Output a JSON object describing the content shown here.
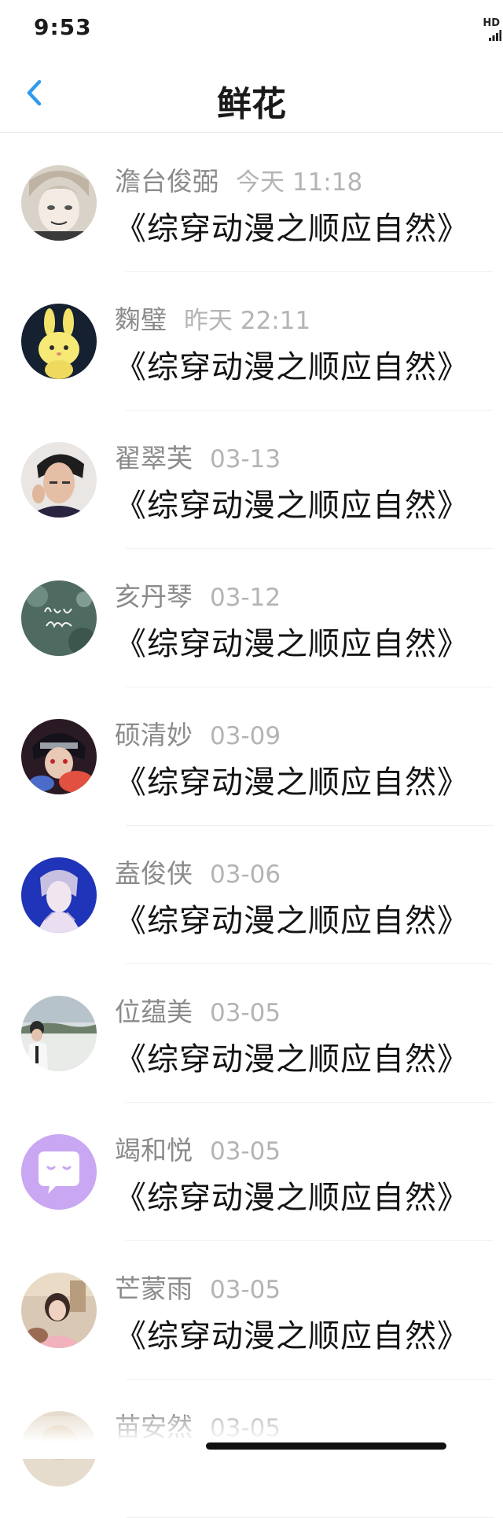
{
  "status_bar": {
    "time": "9:53",
    "hd_badge": "HD",
    "signal_icon": "signal-bars-icon"
  },
  "nav": {
    "title": "鲜花",
    "back_icon": "chevron-left-icon",
    "accent_color": "#2f9bef"
  },
  "items": [
    {
      "name": "澹台俊弼",
      "time": "今天 11:18",
      "book": "《综穿动漫之顺应自然》",
      "avatar": "anime-boy-avatar"
    },
    {
      "name": "麴璧",
      "time": "昨天 22:11",
      "book": "《综穿动漫之顺应自然》",
      "avatar": "yellow-bunny-avatar"
    },
    {
      "name": "翟翠芙",
      "time": "03-13",
      "book": "《综穿动漫之顺应自然》",
      "avatar": "young-man-avatar"
    },
    {
      "name": "亥丹琴",
      "time": "03-12",
      "book": "《综穿动漫之顺应自然》",
      "avatar": "hello-august-avatar"
    },
    {
      "name": "硕清妙",
      "time": "03-09",
      "book": "《综穿动漫之顺应自然》",
      "avatar": "ninja-avatar"
    },
    {
      "name": "盍俊侠",
      "time": "03-06",
      "book": "《综穿动漫之顺应自然》",
      "avatar": "blue-anime-avatar"
    },
    {
      "name": "位蕴美",
      "time": "03-05",
      "book": "《综穿动漫之顺应自然》",
      "avatar": "seaside-man-avatar"
    },
    {
      "name": "竭和悦",
      "time": "03-05",
      "book": "《综穿动漫之顺应自然》",
      "avatar": "purple-chat-avatar"
    },
    {
      "name": "芒蒙雨",
      "time": "03-05",
      "book": "《综穿动漫之顺应自然》",
      "avatar": "girl-photo-avatar"
    },
    {
      "name": "苗安然",
      "time": "03-05",
      "book": "",
      "avatar": "partial-avatar"
    }
  ]
}
